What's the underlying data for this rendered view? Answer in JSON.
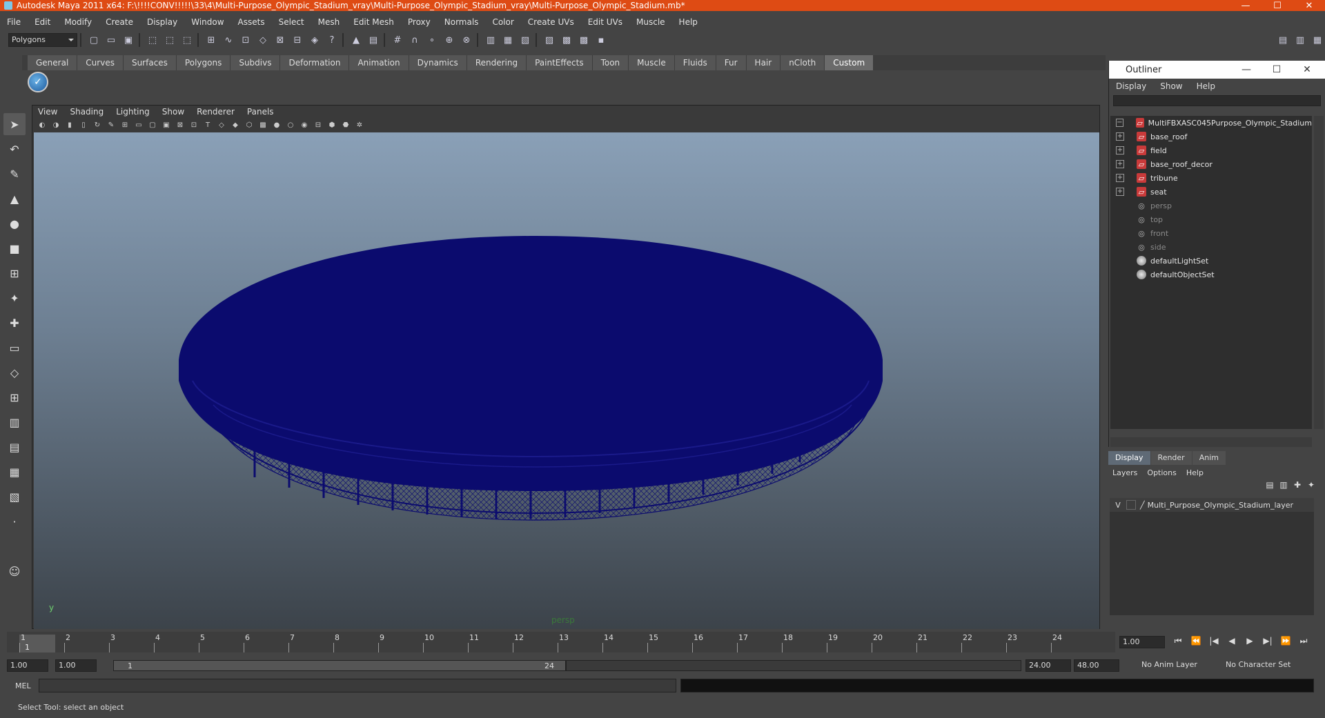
{
  "window": {
    "title": "Autodesk Maya 2011 x64: F:\\!!!!CONV!!!!!\\33\\4\\Multi-Purpose_Olympic_Stadium_vray\\Multi-Purpose_Olympic_Stadium_vray\\Multi-Purpose_Olympic_Stadium.mb*"
  },
  "menubar": [
    "File",
    "Edit",
    "Modify",
    "Create",
    "Display",
    "Window",
    "Assets",
    "Select",
    "Mesh",
    "Edit Mesh",
    "Proxy",
    "Normals",
    "Color",
    "Create UVs",
    "Edit UVs",
    "Muscle",
    "Help"
  ],
  "mode_selector": "Polygons",
  "shelf_tabs": [
    "General",
    "Curves",
    "Surfaces",
    "Polygons",
    "Subdivs",
    "Deformation",
    "Animation",
    "Dynamics",
    "Rendering",
    "PaintEffects",
    "Toon",
    "Muscle",
    "Fluids",
    "Fur",
    "Hair",
    "nCloth",
    "Custom"
  ],
  "active_shelf_tab": "Custom",
  "viewport": {
    "menus": [
      "View",
      "Shading",
      "Lighting",
      "Show",
      "Renderer",
      "Panels"
    ],
    "camera_label": "persp",
    "axis_label": "y",
    "wireframe_color": "#0b0b6e"
  },
  "outliner": {
    "title": "Outliner",
    "menus": [
      "Display",
      "Show",
      "Help"
    ],
    "items": [
      {
        "label": "MultiFBXASC045Purpose_Olympic_Stadium",
        "type": "mesh",
        "expand": "−",
        "dim": false
      },
      {
        "label": "base_roof",
        "type": "mesh",
        "expand": "+",
        "dim": false
      },
      {
        "label": "field",
        "type": "mesh",
        "expand": "+",
        "dim": false
      },
      {
        "label": "base_roof_decor",
        "type": "mesh",
        "expand": "+",
        "dim": false
      },
      {
        "label": "tribune",
        "type": "mesh",
        "expand": "+",
        "dim": false
      },
      {
        "label": "seat",
        "type": "mesh",
        "expand": "+",
        "dim": false
      },
      {
        "label": "persp",
        "type": "cam",
        "expand": "",
        "dim": true
      },
      {
        "label": "top",
        "type": "cam",
        "expand": "",
        "dim": true
      },
      {
        "label": "front",
        "type": "cam",
        "expand": "",
        "dim": true
      },
      {
        "label": "side",
        "type": "cam",
        "expand": "",
        "dim": true
      },
      {
        "label": "defaultLightSet",
        "type": "set",
        "expand": "",
        "dim": false
      },
      {
        "label": "defaultObjectSet",
        "type": "set",
        "expand": "",
        "dim": false
      }
    ]
  },
  "layers": {
    "tabs": [
      "Display",
      "Render",
      "Anim"
    ],
    "active_tab": "Display",
    "menus": [
      "Layers",
      "Options",
      "Help"
    ],
    "rows": [
      {
        "visible": "V",
        "name": "Multi_Purpose_Olympic_Stadium_layer"
      }
    ]
  },
  "timeline": {
    "ticks": [
      "1",
      "2",
      "3",
      "4",
      "5",
      "6",
      "7",
      "8",
      "9",
      "10",
      "11",
      "12",
      "13",
      "14",
      "15",
      "16",
      "17",
      "18",
      "19",
      "20",
      "21",
      "22",
      "23",
      "24"
    ],
    "current_frame": "1",
    "current_time": "1.00"
  },
  "range": {
    "start": "1.00",
    "start2": "1.00",
    "slider_start": "1",
    "slider_end": "24",
    "end": "24.00",
    "end2": "48.00",
    "anim_layer": "No Anim Layer",
    "character_set": "No Character Set"
  },
  "cmdline": {
    "label": "MEL"
  },
  "helpline": "Select Tool: select an object"
}
